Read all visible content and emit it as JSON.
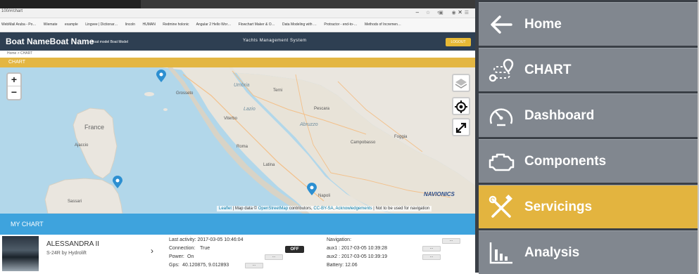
{
  "browser": {
    "address": "100/#/chart",
    "window_controls": "– ▫ ✕",
    "toolbar_icons": "☆ ▣ ◉ ☰",
    "bookmarks": [
      "WebMail Aruba - Po…",
      "Wiemate",
      "example",
      "Lingvee | Dictionar…",
      "lincoln",
      "HUMAN",
      "Redmine holonic",
      "Angular 2 Hello Wor…",
      "Flowchart Maker & O…",
      "Data Modeling with …",
      "Protractor - end-to-…",
      "Methods of Incremen…"
    ]
  },
  "app": {
    "boat_name": "Boat NameBoat Name",
    "boat_model": "Boat model Boat Model",
    "system_title": "Yachts Management System",
    "logout_label": "LOGOUT",
    "breadcrumb": "Home > CHART",
    "section_title": "CHART"
  },
  "map": {
    "zoom_in": "+",
    "zoom_out": "−",
    "labels": {
      "france": "France",
      "grosseto": "Grosseto",
      "umbria": "Umbria",
      "terni": "Terni",
      "pescara": "Pescara",
      "viterbo": "Viterbo",
      "roma": "Roma",
      "latina": "Latina",
      "napoli": "Napoli",
      "ajaccio": "Ajaccio",
      "sassari": "Sassari",
      "campobasso": "Campobasso",
      "foggia": "Foggia",
      "lazio": "Lazio",
      "abruzzo": "Abruzzo"
    },
    "navionics": "NAVIONICS",
    "attribution": {
      "leaflet": "Leaflet",
      "map_data": " | Map data © ",
      "osm": "OpenStreetMap",
      "contributors": " contributors, ",
      "license": "CC-BY-SA",
      "sep": ", ",
      "ack": "Acknowledgements",
      "tail": " | Not to be used for navigation"
    }
  },
  "my_chart": {
    "title": "MY CHART",
    "boat": {
      "name": "ALESSANDRA II",
      "model": "S-24R by Hydrolift",
      "chevron": "›",
      "last_activity": "Last activity: 2017-03-05 10:46:04",
      "connection_label": "Connection:",
      "connection_value": "True",
      "power_label": "Power:",
      "power_value": "On",
      "gps_label": "Gps:",
      "gps_value": "40.120875, 9.012893",
      "off_label": "OFF",
      "navigation_label": "Navigation:",
      "aux1": "aux1 : 2017-03-05 10:39:28",
      "aux2": "aux2 : 2017-03-05 10:39:19",
      "battery": "Battery: 12.06",
      "dots": "..."
    }
  },
  "menu": {
    "items": [
      {
        "label": "Home",
        "icon": "arrow-left-icon"
      },
      {
        "label": "CHART",
        "icon": "route-pin-icon"
      },
      {
        "label": "Dashboard",
        "icon": "speedometer-icon"
      },
      {
        "label": "Components",
        "icon": "engine-icon"
      },
      {
        "label": "Servicings",
        "icon": "wrench-screwdriver-icon",
        "active": true
      },
      {
        "label": "Analysis",
        "icon": "bar-chart-icon"
      }
    ],
    "active_color": "#e3b43f",
    "item_color": "#81878f"
  }
}
